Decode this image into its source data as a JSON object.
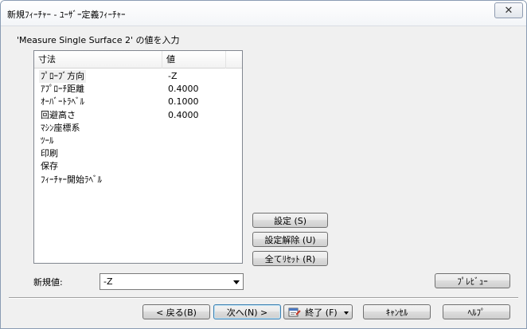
{
  "window": {
    "title": "新規ﾌｨｰﾁｬｰ - ﾕｰｻﾞｰ定義ﾌｨｰﾁｬｰ",
    "close_symbol": "✕"
  },
  "prompt": "'Measure Single Surface 2' の値を入力",
  "table": {
    "columns": [
      "寸法",
      "値"
    ],
    "rows": [
      {
        "name": "ﾌﾟﾛｰﾌﾞ方向",
        "value": "-Z"
      },
      {
        "name": "ｱﾌﾟﾛｰﾁ距離",
        "value": "0.4000"
      },
      {
        "name": "ｵｰﾊﾞｰﾄﾗﾍﾞﾙ",
        "value": "0.1000"
      },
      {
        "name": "回避高さ",
        "value": "0.4000"
      },
      {
        "name": "ﾏｼﾝ座標系",
        "value": ""
      },
      {
        "name": "ﾂｰﾙ",
        "value": ""
      },
      {
        "name": "印刷",
        "value": ""
      },
      {
        "name": "保存",
        "value": ""
      },
      {
        "name": "ﾌｨｰﾁｬｰ開始ﾗﾍﾞﾙ",
        "value": ""
      }
    ],
    "selected_index": 0
  },
  "actions": {
    "set": "設定 (S)",
    "unset": "設定解除 (U)",
    "reset_all": "全てﾘｾｯﾄ (R)",
    "preview": "ﾌﾟﾚﾋﾞｭｰ"
  },
  "new_value": {
    "label": "新規値:",
    "value": "-Z"
  },
  "footer": {
    "back": "< 戻る(B)",
    "next": "次へ(N) >",
    "finish": "終了 (F)",
    "cancel": "ｷｬﾝｾﾙ",
    "help": "ﾍﾙﾌﾟ"
  },
  "colors": {
    "focus_border": "#3c7fb1",
    "panel_border": "#828790",
    "dialog_bg": "#f0f0f0"
  }
}
